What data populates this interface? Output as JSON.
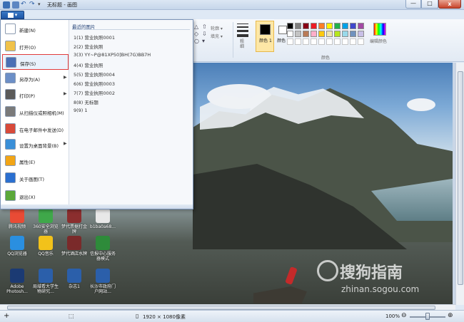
{
  "window": {
    "title": "无标题 - 画图",
    "min": "—",
    "max": "□",
    "close": "x"
  },
  "file_tab": {
    "label": "▾"
  },
  "ribbon": {
    "outline": "轮廓 ▾",
    "fill": "填充 ▾",
    "size_label": "粗细",
    "color1": "颜色 1",
    "color2": "颜色 2",
    "edit_colors": "编辑颜色",
    "group_colors": "颜色",
    "palette": [
      "#000000",
      "#7f7f7f",
      "#880015",
      "#ed1c24",
      "#ff7f27",
      "#fff200",
      "#22b14c",
      "#00a2e8",
      "#3f48cc",
      "#a349a4",
      "#ffffff",
      "#c3c3c3",
      "#b97a57",
      "#ffaec9",
      "#ffc90e",
      "#efe4b0",
      "#b5e61d",
      "#99d9ea",
      "#7092be",
      "#c8bfe7"
    ]
  },
  "file_menu": {
    "items": [
      {
        "label": "新建(N)",
        "icon": "new-file-icon",
        "arrow": ""
      },
      {
        "label": "打开(O)",
        "icon": "open-folder-icon",
        "arrow": ""
      },
      {
        "label": "保存(S)",
        "icon": "save-icon",
        "arrow": ""
      },
      {
        "label": "另存为(A)",
        "icon": "save-as-icon",
        "arrow": "▶"
      },
      {
        "label": "打印(P)",
        "icon": "printer-icon",
        "arrow": "▶"
      },
      {
        "label": "从扫描仪或照相机(M)",
        "icon": "scanner-icon",
        "arrow": ""
      },
      {
        "label": "在电子邮件中发送(D)",
        "icon": "email-icon",
        "arrow": ""
      },
      {
        "label": "设置为桌面背景(B)",
        "icon": "desktop-icon",
        "arrow": "▶"
      },
      {
        "label": "属性(E)",
        "icon": "properties-check-icon",
        "arrow": ""
      },
      {
        "label": "关于画图(T)",
        "icon": "info-icon",
        "arrow": ""
      },
      {
        "label": "退出(X)",
        "icon": "exit-icon",
        "arrow": ""
      }
    ],
    "recent_title": "最近的图片",
    "recent": [
      "1(1)   营业执照0001",
      "2(2)   营业执照",
      "3(3)   YY~P@81XP50]BH(7G)BB7H",
      "4(4)   营业执照",
      "5(5)   营业执照0004",
      "6(6)   营业执照0003",
      "7(7)   营业执照0002",
      "8(8)   无标题",
      "9(9)   1"
    ]
  },
  "desktop_icons": [
    {
      "label": "腾讯视频",
      "color": "#e94b35"
    },
    {
      "label": "360安全浏览器",
      "color": "#3fa84a"
    },
    {
      "label": "梦代票据打金牌",
      "color": "#8b2e2e"
    },
    {
      "label": "b1ba0a68...",
      "color": "#e8e8e8"
    },
    {
      "label": "QQ浏览器",
      "color": "#2a8fe0"
    },
    {
      "label": "QQ音乐",
      "color": "#f2c21a"
    },
    {
      "label": "梦代酒店水牌",
      "color": "#7a2a2a"
    },
    {
      "label": "信报中心服务器模式",
      "color": "#2e8b3a"
    },
    {
      "label": "Adobe Photosh...",
      "color": "#1b3a73"
    },
    {
      "label": "局域看大学生物研究...",
      "color": "#2b5faa"
    },
    {
      "label": "杂志1",
      "color": "#2b5faa"
    },
    {
      "label": "长沙市政府门户网站...",
      "color": "#2b5faa"
    }
  ],
  "watermark": {
    "cn": "搜狗指南",
    "en": "zhinan.sogou.com"
  },
  "statusbar": {
    "add": "+",
    "dimensions": "1920 × 1080像素",
    "zoom": "100%",
    "minus": "⊖",
    "plus": "⊕"
  }
}
